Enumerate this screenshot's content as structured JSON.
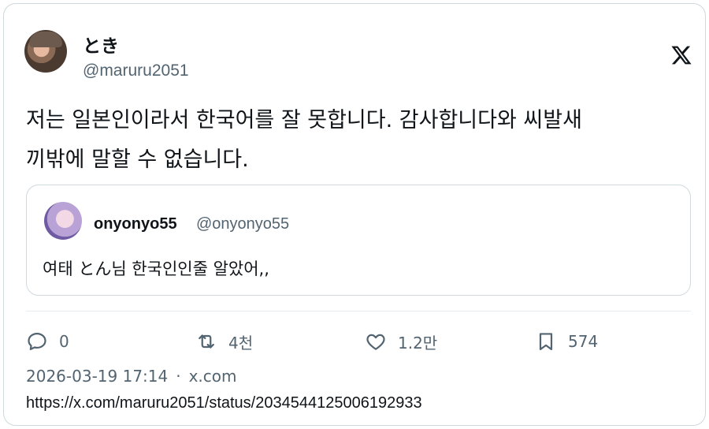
{
  "author": {
    "display_name": "とき",
    "handle": "@maruru2051"
  },
  "tweet": {
    "text_line1": "저는 일본인이라서 한국어를 잘 못합니다. 감사합니다와 씨발새",
    "text_line2": "끼밖에 말할 수 없습니다."
  },
  "quoted": {
    "display_name": "onyonyo55",
    "handle": "@onyonyo55",
    "text": "여태 とん님 한국인인줄 알았어,,"
  },
  "stats": {
    "replies": "0",
    "retweets": "4천",
    "likes": "1.2만",
    "bookmarks": "574"
  },
  "meta": {
    "timestamp": "2026-03-19 17:14",
    "separator": "·",
    "source": "x.com",
    "url": "https://x.com/maruru2051/status/2034544125006192933"
  },
  "icons": {
    "logo": "x-logo-icon",
    "reply": "reply-icon",
    "retweet": "retweet-icon",
    "like": "heart-icon",
    "bookmark": "bookmark-icon"
  }
}
